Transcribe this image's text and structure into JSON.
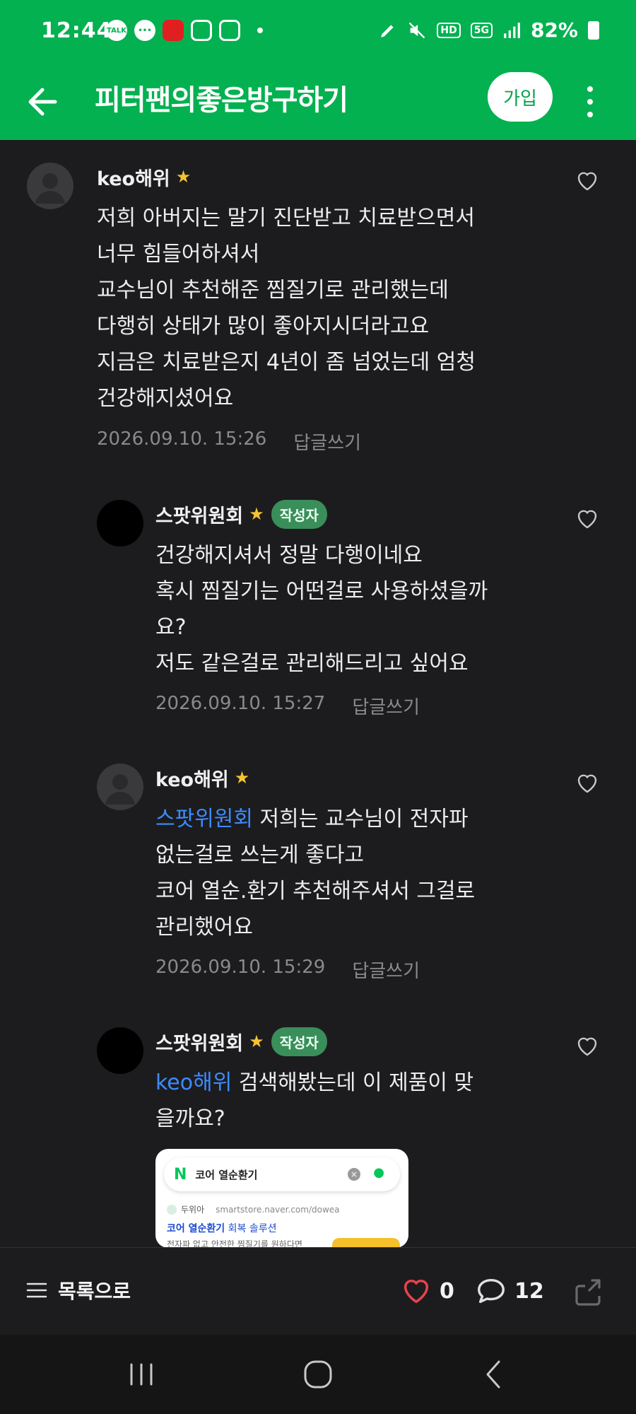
{
  "status_bar": {
    "time": "12:44",
    "left_icons": [
      "talk-icon",
      "chat-icon",
      "red-app-icon",
      "instagram-icon",
      "instagram-icon"
    ],
    "battery": "82%",
    "network": "5G",
    "hd": "HD"
  },
  "header": {
    "title": "피터팬의좋은방구하기",
    "join_label": "가입"
  },
  "comments": [
    {
      "nickname": "keo해위",
      "lines": [
        "저희 아버지는 말기 진단받고 치료받으면서",
        "너무 힘들어하셔서",
        "교수님이 추천해준 찜질기로 관리했는데",
        "다행히 상태가 많이 좋아지시더라고요",
        "지금은 치료받은지 4년이 좀 넘었는데 엄청",
        "건강해지셨어요"
      ],
      "date": "2026.09.10. 15:26",
      "reply_label": "답글쓰기"
    },
    {
      "nickname": "스팟위원회",
      "badge": "작성자",
      "lines": [
        "건강해지셔서 정말 다행이네요",
        "혹시 찜질기는 어떤걸로 사용하셨을까",
        "요?",
        "저도 같은걸로 관리해드리고 싶어요"
      ],
      "date": "2026.09.10. 15:27",
      "reply_label": "답글쓰기"
    },
    {
      "nickname": "keo해위",
      "mention": "스팟위원회",
      "first_line_rest": " 저희는 교수님이 전자파",
      "lines": [
        "없는걸로 쓰는게 좋다고",
        "코어 열순.환기 추천해주셔서 그걸로",
        "관리했어요"
      ],
      "date": "2026.09.10. 15:29",
      "reply_label": "답글쓰기"
    },
    {
      "nickname": "스팟위원회",
      "badge": "작성자",
      "mention": "keo해위",
      "first_line_rest": " 검색해봤는데 이 제품이 맞",
      "lines": [
        "을까요?"
      ]
    }
  ],
  "card": {
    "logo": "N",
    "query": "코어 열순환기",
    "site_name": "두위아",
    "site_url": "smartstore.naver.com/dowea",
    "link_title": "코어 열순환기",
    "link_rest": " 회복 솔루션",
    "snippet": "전자파 없고 안전한 찜질기를 원하다면"
  },
  "toolbar": {
    "list_label": "목록으로",
    "like_count": "0",
    "comment_count": "12"
  },
  "colors": {
    "brand_green": "#03b150",
    "mention_blue": "#3d8bff",
    "badge_green": "#3a8e5a",
    "like_red": "#e8434b"
  }
}
